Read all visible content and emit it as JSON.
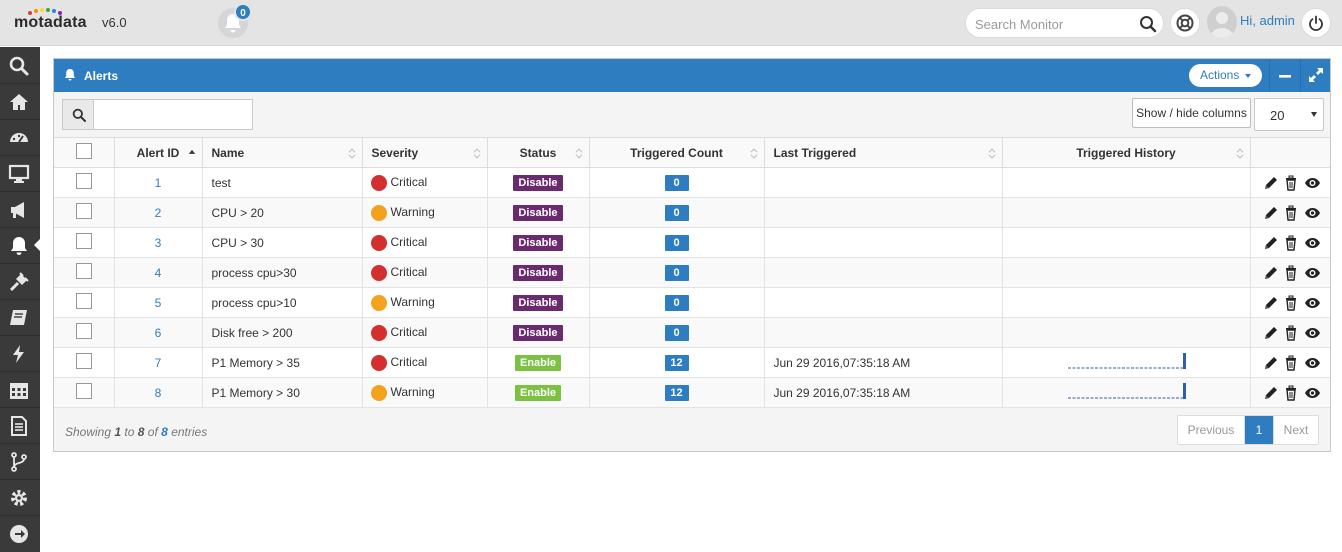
{
  "header": {
    "logo": "motadata",
    "version": "v6.0",
    "notification_count": "0",
    "search_placeholder": "Search Monitor",
    "greeting": "Hi, admin"
  },
  "nav": {
    "items": [
      "search-icon",
      "home-icon",
      "dashboard-icon",
      "monitor-icon",
      "megaphone-icon",
      "bell-icon",
      "plug-icon",
      "book-icon",
      "bolt-icon",
      "calendar-icon",
      "report-icon",
      "flow-icon",
      "settings-icon",
      "arrow-right-icon"
    ],
    "active": "bell-icon"
  },
  "panel": {
    "title": "Alerts",
    "actions_label": "Actions",
    "show_hide_label": "Show / hide columns",
    "page_size": "20"
  },
  "table": {
    "columns": [
      "Alert ID",
      "Name",
      "Severity",
      "Status",
      "Triggered Count",
      "Last Triggered",
      "Triggered History"
    ],
    "rows": [
      {
        "id": "1",
        "name": "test",
        "severity": "Critical",
        "status": "Disable",
        "count": "0",
        "last": ""
      },
      {
        "id": "2",
        "name": "CPU > 20",
        "severity": "Warning",
        "status": "Disable",
        "count": "0",
        "last": ""
      },
      {
        "id": "3",
        "name": "CPU > 30",
        "severity": "Critical",
        "status": "Disable",
        "count": "0",
        "last": ""
      },
      {
        "id": "4",
        "name": "process cpu>30",
        "severity": "Critical",
        "status": "Disable",
        "count": "0",
        "last": ""
      },
      {
        "id": "5",
        "name": "process cpu>10",
        "severity": "Warning",
        "status": "Disable",
        "count": "0",
        "last": ""
      },
      {
        "id": "6",
        "name": "Disk free > 200",
        "severity": "Critical",
        "status": "Disable",
        "count": "0",
        "last": ""
      },
      {
        "id": "7",
        "name": "P1 Memory > 35",
        "severity": "Critical",
        "status": "Enable",
        "count": "12",
        "last": "Jun 29 2016,07:35:18 AM"
      },
      {
        "id": "8",
        "name": "P1 Memory > 30",
        "severity": "Warning",
        "status": "Enable",
        "count": "12",
        "last": "Jun 29 2016,07:35:18 AM"
      }
    ]
  },
  "footer": {
    "showing_prefix": "Showing",
    "from": "1",
    "to_word": "to",
    "to": "8",
    "of_word": "of",
    "total": "8",
    "entries_word": "entries",
    "prev_label": "Previous",
    "current_page": "1",
    "next_label": "Next"
  },
  "colors": {
    "brand_blue": "#2f7dc1",
    "critical": "#d32f2f",
    "warning": "#f4a11d",
    "disable_badge": "#6a2a6e",
    "enable_badge": "#7cc242",
    "nav_bg": "#3a3a3a"
  }
}
